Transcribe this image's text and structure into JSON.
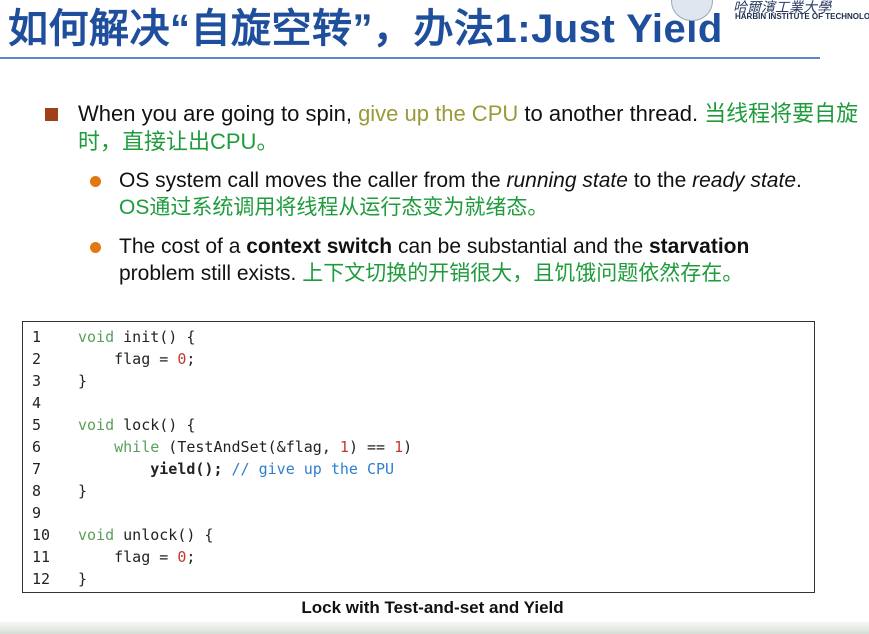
{
  "slide": {
    "title": "如何解决“自旋空转”，办法1:Just Yield",
    "logo_script": "哈爾濱工業大學",
    "logo_name": "HARBIN INSTITUTE OF TECHNOLOGY"
  },
  "bullets": {
    "b1": {
      "part1": "When you are going to spin, ",
      "part2": "give up the CPU",
      "part3": " to another thread. ",
      "part4": "当线程将要自旋时，直接让出CPU。"
    },
    "b2": {
      "part1": "OS system call moves the caller from the ",
      "part2": "running state",
      "part3": " to the ",
      "part4": "ready state",
      "part5": ". ",
      "part6": "OS通过系统调用将线程从运行态变为就绪态。"
    },
    "b3": {
      "part1": "The cost of a ",
      "part2": "context switch",
      "part3": " can be substantial and the ",
      "part4": "starvation",
      "part5": " problem still exists. ",
      "part6": "上下文切换的开销很大，且饥饿问题依然存在。"
    }
  },
  "code": {
    "lines": [
      {
        "n": "1",
        "t1": "void",
        "t2": " init() {"
      },
      {
        "n": "2",
        "t1": "    flag = ",
        "t2": "0",
        "t3": ";"
      },
      {
        "n": "3",
        "t1": "}"
      },
      {
        "n": "4"
      },
      {
        "n": "5",
        "t1": "void",
        "t2": " lock() {"
      },
      {
        "n": "6",
        "t1": "    ",
        "t2": "while",
        "t3": " (TestAndSet(&flag, ",
        "t4": "1",
        "t5": ") == ",
        "t6": "1",
        "t7": ")"
      },
      {
        "n": "7",
        "t1": "        ",
        "t2": "yield();",
        "t3": " ",
        "t4": "// give up the CPU"
      },
      {
        "n": "8",
        "t1": "}"
      },
      {
        "n": "9"
      },
      {
        "n": "10",
        "t1": "void",
        "t2": " unlock() {"
      },
      {
        "n": "11",
        "t1": "    flag = ",
        "t2": "0",
        "t3": ";"
      },
      {
        "n": "12",
        "t1": "}"
      }
    ]
  },
  "caption": "Lock with Test-and-set and Yield",
  "colors": {
    "title": "#1f4e9c",
    "olive": "#9a9a38",
    "green": "#1e9c3c",
    "bullet_square": "#a0401a",
    "bullet_dot": "#e07a10"
  }
}
